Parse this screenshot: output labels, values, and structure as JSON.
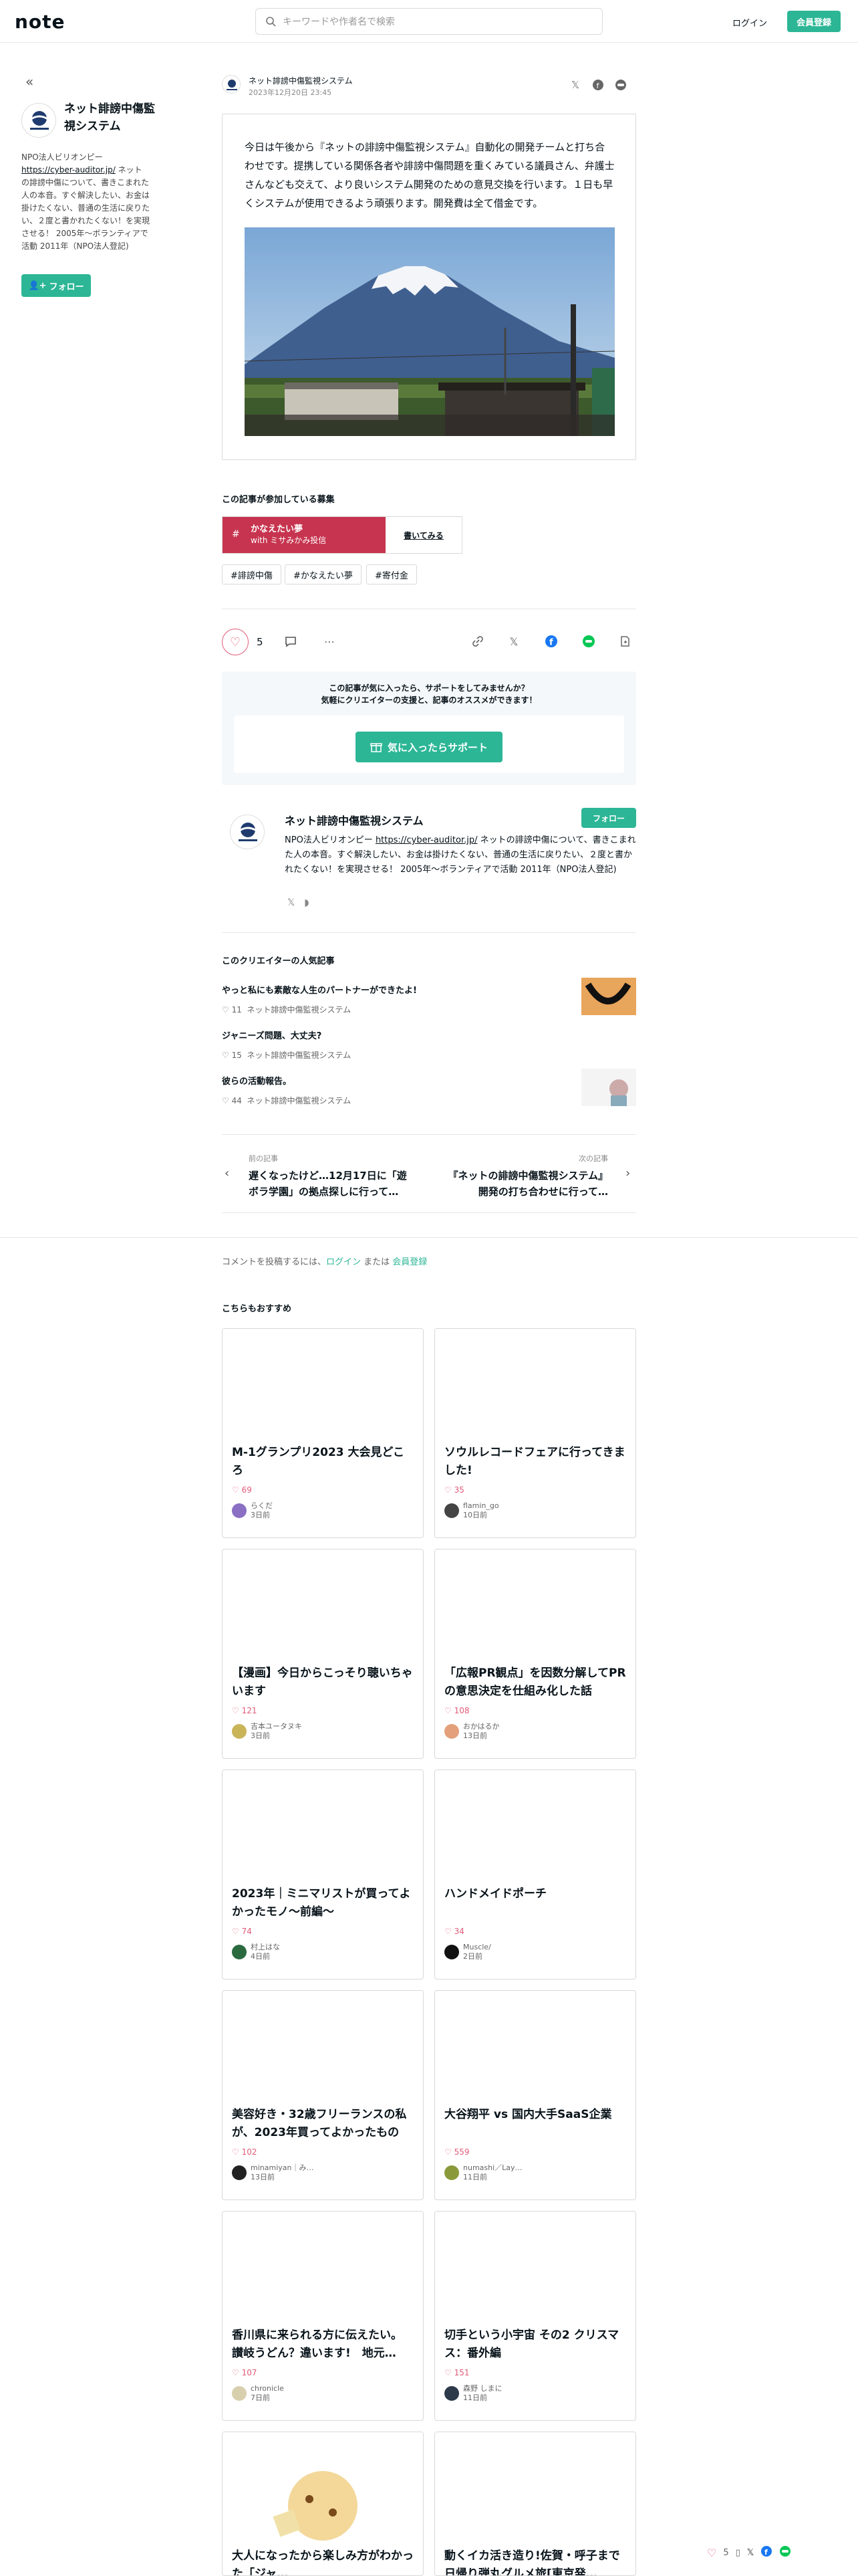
{
  "header": {
    "logo": "note",
    "search_placeholder": "キーワードや作者名で検索",
    "login": "ログイン",
    "signup": "会員登録"
  },
  "sidebar": {
    "name": "ネット誹謗中傷監視システム",
    "bio_pre": "NPO法人ビリオンピー ",
    "bio_link": "https://cyber-auditor.jp/",
    "bio_post": " ネットの誹謗中傷について、書きこまれた人の本音。すぐ解決したい、お金は掛けたくない、普通の生活に戻りたい、２度と書かれたくない！を実現させる！ 2005年〜ボランティアで活動 2011年（NPO法人登記)",
    "follow": "フォロー"
  },
  "article": {
    "author": "ネット誹謗中傷監視システム",
    "date": "2023年12月20日 23:45",
    "body": "今日は午後から『ネットの誹謗中傷監視システム』自動化の開発チームと打ち合わせです。提携している関係各者や誹謗中傷問題を重くみている議員さん、弁護士さんなども交えて、より良いシステム開発のための意見交換を行います。１日も早くシステムが使用できるよう頑張ります。開発費は全て借金です。"
  },
  "contest": {
    "section_title": "この記事が参加している募集",
    "name": "かなえたい夢",
    "sub": "with ミサ",
    "sub2": "みかみ投信",
    "cta": "書いてみる"
  },
  "tags": [
    "#誹謗中傷",
    "#かなえたい夢",
    "#寄付金"
  ],
  "actions": {
    "like_count": "5"
  },
  "support": {
    "line1": "この記事が気に入ったら、サポートをしてみませんか？",
    "line2": "気軽にクリエイターの支援と、記事のオススメができます！",
    "button": "気に入ったらサポート"
  },
  "creator": {
    "name": "ネット誹謗中傷監視システム",
    "follow": "フォロー",
    "bio_pre": "NPO法人ビリオンピー ",
    "bio_link": "https://cyber-auditor.jp/",
    "bio_post": " ネットの誹謗中傷について、書きこまれた人の本音。すぐ解決したい、お金は掛けたくない、普通の生活に戻りたい、２度と書かれたくない！を実現させる！ 2005年〜ボランティアで活動 2011年（NPO法人登記)"
  },
  "popular": {
    "title": "このクリエイターの人気記事",
    "items": [
      {
        "title": "やっと私にも素敵な人生のパートナーができたよ!",
        "likes": "11",
        "author": "ネット誹謗中傷監視システム"
      },
      {
        "title": "ジャニーズ問題、大丈夫?",
        "likes": "15",
        "author": "ネット誹謗中傷監視システム"
      },
      {
        "title": "彼らの活動報告。",
        "likes": "44",
        "author": "ネット誹謗中傷監視システム"
      }
    ]
  },
  "nav": {
    "prev_label": "前の記事",
    "prev_title": "遅くなったけど…12月17日に「遊ボラ学園」の拠点探しに行って…",
    "next_label": "次の記事",
    "next_title": "『ネットの誹謗中傷監視システム』開発の打ち合わせに行って…"
  },
  "comment": {
    "pre": "コメントを投稿するには、",
    "login": "ログイン",
    "mid": " または ",
    "signup": "会員登録"
  },
  "recommend": {
    "title": "こちらもおすすめ",
    "cards": [
      {
        "title": "M-1グランプリ2023 大会見どころ",
        "likes": "69",
        "user": "らくだ",
        "time": "3日前",
        "av": "#8a6fc2"
      },
      {
        "title": "ソウルレコードフェアに行ってきました!",
        "likes": "35",
        "user": "flamin_go",
        "time": "10日前",
        "av": "#444"
      },
      {
        "title": "【漫画】今日からこっそり聴いちゃいます",
        "likes": "121",
        "user": "吉本ユータヌキ",
        "time": "3日前",
        "av": "#c9b458"
      },
      {
        "title": "「広報PR観点」を因数分解してPRの意思決定を仕組み化した話",
        "likes": "108",
        "user": "おかはるか",
        "time": "13日前",
        "av": "#e3a07a"
      },
      {
        "title": "2023年｜ミニマリストが買ってよかったモノ〜前編〜",
        "likes": "74",
        "user": "村上はな",
        "time": "4日前",
        "av": "#2b6a3f"
      },
      {
        "title": "ハンドメイドポーチ",
        "likes": "34",
        "user": "Muscle/",
        "time": "2日前",
        "av": "#111"
      },
      {
        "title": "美容好き・32歳フリーランスの私が、2023年買ってよかったもの",
        "likes": "102",
        "user": "minamiyan｜み…",
        "time": "13日前",
        "av": "#222"
      },
      {
        "title": "大谷翔平 vs 国内大手SaaS企業",
        "likes": "559",
        "user": "numashi／Lay…",
        "time": "11日前",
        "av": "#8a9a3a"
      },
      {
        "title": "香川県に来られる方に伝えたい。 讃岐うどん？違います!　地元…",
        "likes": "107",
        "user": "chronicle",
        "time": "7日前",
        "av": "#d8cfae"
      },
      {
        "title": "切手という小宇宙 その2 クリスマス：番外編",
        "likes": "151",
        "user": "森野 しまに",
        "time": "11日前",
        "av": "#2d3a4a"
      },
      {
        "title": "大人になったから楽しみ方がわかった「ジャ…",
        "likes": "",
        "user": "",
        "time": "",
        "av": "#fff"
      },
      {
        "title": "動くイカ活き造り!佐賀・呼子まで日帰り弾丸グルメ旅[東京発…",
        "likes": "",
        "user": "",
        "time": "",
        "av": "#fff"
      }
    ]
  },
  "floating": {
    "likes": "5"
  }
}
